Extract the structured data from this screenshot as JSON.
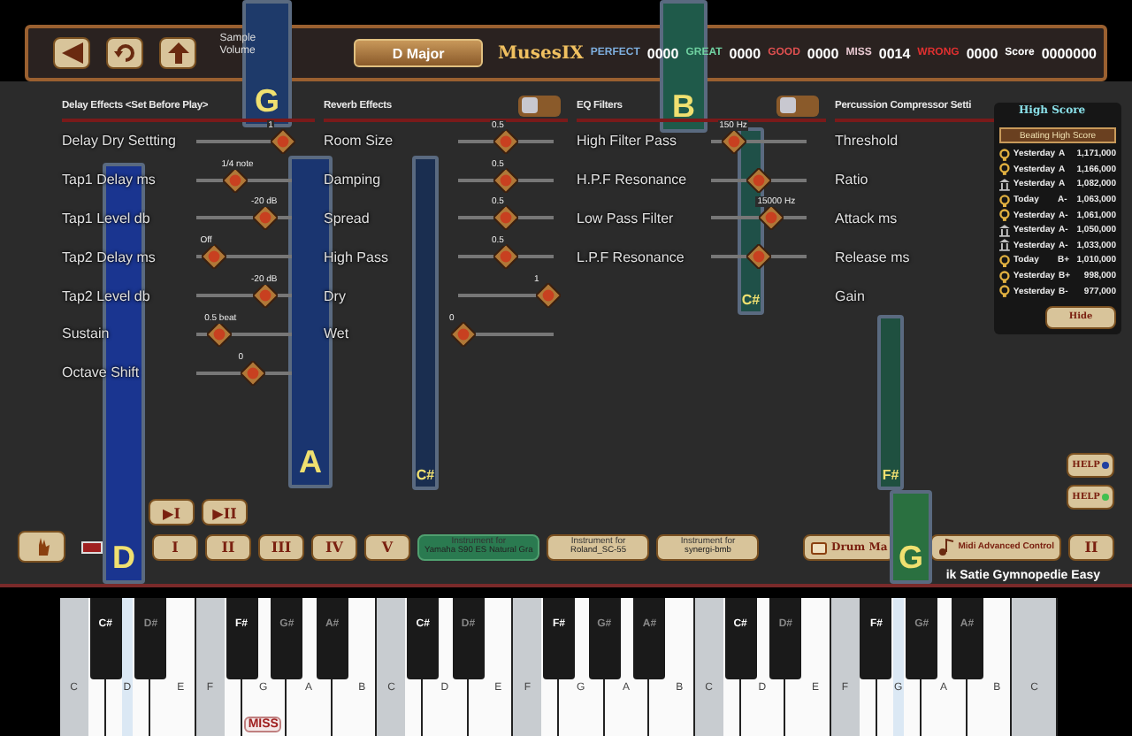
{
  "top_bar": {
    "volume_label": "Sample Volume",
    "key": "D Major",
    "logo": "MusesIX",
    "counters": [
      {
        "label": "PERFECT",
        "value": "0000",
        "color": "#7fb0e0"
      },
      {
        "label": "GREAT",
        "value": "0000",
        "color": "#6fd0a0"
      },
      {
        "label": "GOOD",
        "value": "0000",
        "color": "#e05050"
      },
      {
        "label": "MISS",
        "value": "0014",
        "color": "#e8c8d0"
      },
      {
        "label": "WRONG",
        "value": "0000",
        "color": "#e03030"
      },
      {
        "label": "Score",
        "value": "0000000",
        "color": "#ffffff"
      }
    ]
  },
  "sections": [
    {
      "title": "Delay Effects <Set Before Play>",
      "rows": [
        {
          "label": "Delay Dry Settting",
          "value": "1",
          "level": 0.95
        },
        {
          "label": "Tap1 Delay ms",
          "value": "1/4 note",
          "level": 0.4
        },
        {
          "label": "Tap1 Level db",
          "value": "-20 dB",
          "level": 0.75
        },
        {
          "label": "Tap2 Delay ms",
          "value": "Off",
          "level": 0.15
        },
        {
          "label": "Tap2 Level db",
          "value": "-20 dB",
          "level": 0.75
        },
        {
          "label": "Sustain",
          "value": "0.5 beat",
          "level": 0.2
        },
        {
          "label": "Octave Shift",
          "value": "0",
          "level": 0.6
        }
      ]
    },
    {
      "title": "Reverb Effects",
      "toggle": {
        "on": false
      },
      "rows": [
        {
          "label": "Room Size",
          "value": "0.5",
          "level": 0.5
        },
        {
          "label": "Damping",
          "value": "0.5",
          "level": 0.5
        },
        {
          "label": "Spread",
          "value": "0.5",
          "level": 0.5
        },
        {
          "label": "High Pass",
          "value": "0.5",
          "level": 0.5
        },
        {
          "label": "Dry",
          "value": "1",
          "level": 1
        },
        {
          "label": "Wet",
          "value": "0",
          "level": 0
        }
      ]
    },
    {
      "title": "EQ Filters",
      "toggle": {
        "on": false
      },
      "rows": [
        {
          "label": "High Filter Pass",
          "value": "150 Hz",
          "level": 0.2
        },
        {
          "label": "H.P.F Resonance",
          "level": 0.5
        },
        {
          "label": "Low Pass Filter",
          "value": "15000 Hz",
          "level": 0.65
        },
        {
          "label": "L.P.F Resonance",
          "level": 0.5
        }
      ]
    },
    {
      "title": "Percussion Compressor Setti",
      "rows": [
        {
          "label": "Threshold"
        },
        {
          "label": "Ratio"
        },
        {
          "label": "Attack ms"
        },
        {
          "label": "Release ms"
        },
        {
          "label": "Gain"
        }
      ]
    }
  ],
  "high_score": {
    "logo": "High Score",
    "banner": "Beating High Score",
    "rows": [
      {
        "kind": "bulb",
        "date": "Yesterday",
        "grade": "A",
        "score": "1,171,000"
      },
      {
        "kind": "bulb",
        "date": "Yesterday",
        "grade": "A",
        "score": "1,166,000"
      },
      {
        "kind": "pillar",
        "date": "Yesterday",
        "grade": "A",
        "score": "1,082,000"
      },
      {
        "kind": "bulb",
        "date": "Today",
        "grade": "A-",
        "score": "1,063,000"
      },
      {
        "kind": "bulb",
        "date": "Yesterday",
        "grade": "A-",
        "score": "1,061,000"
      },
      {
        "kind": "pillar",
        "date": "Yesterday",
        "grade": "A-",
        "score": "1,050,000"
      },
      {
        "kind": "pillar",
        "date": "Yesterday",
        "grade": "A-",
        "score": "1,033,000"
      },
      {
        "kind": "bulb",
        "date": "Today",
        "grade": "B+",
        "score": "1,010,000"
      },
      {
        "kind": "bulb",
        "date": "Yesterday",
        "grade": "B+",
        "score": "998,000"
      },
      {
        "kind": "bulb",
        "date": "Yesterday",
        "grade": "B-",
        "score": "977,000"
      }
    ],
    "hide_button": "Hide"
  },
  "falling_notes": [
    {
      "label": "G",
      "color": "#1e3a6a"
    },
    {
      "label": "B",
      "color": "#1f5a4a"
    },
    {
      "label": "D",
      "color": "#1a3590"
    },
    {
      "label": "A",
      "color": "#1a3570"
    },
    {
      "label": "C#",
      "color": "#1a2e50"
    },
    {
      "label": "C#",
      "color": "#1f5048"
    },
    {
      "label": "F#",
      "color": "#1f5040"
    },
    {
      "label": "G",
      "color": "#2a7040"
    }
  ],
  "help_buttons": [
    {
      "label": "HELP",
      "color": "#2040a0"
    },
    {
      "label": "HELP",
      "color": "#40c050"
    }
  ],
  "play_buttons": [
    "▶I",
    "▶II"
  ],
  "chord_buttons": [
    "I",
    "II",
    "III",
    "IV",
    "V"
  ],
  "instruments": [
    {
      "caption": "Instrument for",
      "name": "Yamaha S90 ES Natural Gra",
      "selected": true
    },
    {
      "caption": "Instrument for",
      "name": "Roland_SC-55",
      "selected": false
    },
    {
      "caption": "Instrument for",
      "name": "synergi-bmb",
      "selected": false
    }
  ],
  "drum_button": "Drum Ma",
  "advanced_button": "Midi Advanced Control",
  "pause_button": "II",
  "song_title": "ik Satie Gymnopedie Easy",
  "keyboard": {
    "white_keys": [
      {
        "label": "C",
        "kind": "grey"
      },
      {
        "label": "D",
        "kind": "lit"
      },
      {
        "label": "E",
        "kind": "plain"
      },
      {
        "label": "F",
        "kind": "grey"
      },
      {
        "label": "G",
        "kind": "plain",
        "badge": "MISS"
      },
      {
        "label": "A",
        "kind": "plain"
      },
      {
        "label": "B",
        "kind": "plain"
      },
      {
        "label": "C",
        "kind": "grey"
      },
      {
        "label": "D",
        "kind": "plain"
      },
      {
        "label": "E",
        "kind": "plain"
      },
      {
        "label": "F",
        "kind": "grey"
      },
      {
        "label": "G",
        "kind": "plain"
      },
      {
        "label": "A",
        "kind": "plain"
      },
      {
        "label": "B",
        "kind": "plain"
      },
      {
        "label": "C",
        "kind": "grey"
      },
      {
        "label": "D",
        "kind": "plain"
      },
      {
        "label": "E",
        "kind": "plain"
      },
      {
        "label": "F",
        "kind": "grey"
      },
      {
        "label": "G",
        "kind": "lit"
      },
      {
        "label": "A",
        "kind": "plain"
      },
      {
        "label": "B",
        "kind": "plain"
      },
      {
        "label": "C",
        "kind": "grey"
      }
    ],
    "black_keys": [
      {
        "label": "C#",
        "dim": false
      },
      {
        "label": "D#",
        "dim": true
      },
      {
        "label": "F#",
        "dim": false
      },
      {
        "label": "G#",
        "dim": true
      },
      {
        "label": "A#",
        "dim": true
      },
      {
        "label": "C#",
        "dim": false
      },
      {
        "label": "D#",
        "dim": true
      },
      {
        "label": "F#",
        "dim": false
      },
      {
        "label": "G#",
        "dim": true
      },
      {
        "label": "A#",
        "dim": true
      },
      {
        "label": "C#",
        "dim": false
      },
      {
        "label": "D#",
        "dim": true
      },
      {
        "label": "F#",
        "dim": false
      },
      {
        "label": "G#",
        "dim": true
      },
      {
        "label": "A#",
        "dim": true
      }
    ]
  }
}
